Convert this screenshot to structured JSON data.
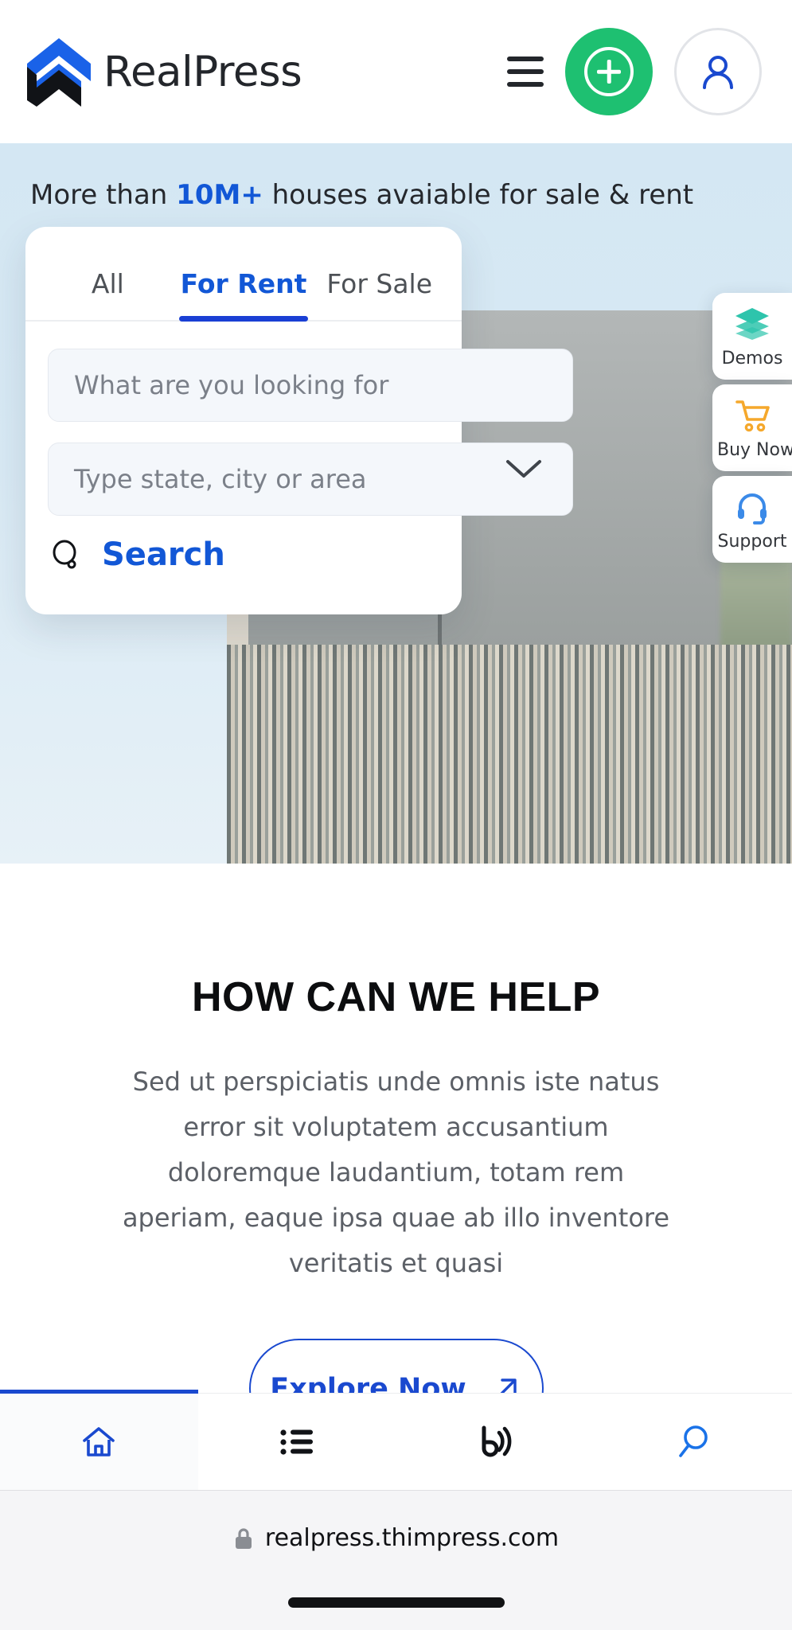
{
  "header": {
    "brand_name": "RealPress",
    "logo_icon": "chevron-logo-icon",
    "menu_icon": "hamburger-menu-icon",
    "add_icon": "plus-circle-icon",
    "account_icon": "user-avatar-icon",
    "accent_green": "#1ec071",
    "accent_blue": "#1257d6"
  },
  "hero": {
    "tagline_prefix": "More than ",
    "tagline_highlight": "10M+",
    "tagline_suffix": " houses avaiable for sale & rent",
    "background_color": "#d8e9f4"
  },
  "search_card": {
    "tabs": [
      {
        "label": "All",
        "active": false
      },
      {
        "label": "For Rent",
        "active": true
      },
      {
        "label": "For Sale",
        "active": false
      }
    ],
    "keyword_placeholder": "What are you looking for",
    "location_placeholder": "Type state, city or area",
    "search_label": "Search",
    "search_icon": "magnifier-icon",
    "dropdown_icon": "chevron-down-icon"
  },
  "float_widgets": [
    {
      "label": "Demos",
      "icon": "layers-icon",
      "color": "#2ec4ac"
    },
    {
      "label": "Buy Now",
      "icon": "shopping-cart-icon",
      "color": "#f5a82c"
    },
    {
      "label": "Support",
      "icon": "headset-icon",
      "color": "#3b8ae8"
    }
  ],
  "help": {
    "title": "HOW CAN WE HELP",
    "description": "Sed ut perspiciatis unde omnis iste natus error sit voluptatem accusantium doloremque laudantium, totam rem aperiam, eaque ipsa quae ab illo inventore veritatis et quasi",
    "explore_label": "Explore Now",
    "explore_icon": "arrow-up-right-icon"
  },
  "bottom_nav": [
    {
      "icon": "home-icon",
      "active": true
    },
    {
      "icon": "list-icon",
      "active": false
    },
    {
      "icon": "blog-icon",
      "active": false
    },
    {
      "icon": "search-icon",
      "active": false
    }
  ],
  "browser": {
    "url": "realpress.thimpress.com",
    "lock_icon": "lock-icon"
  }
}
